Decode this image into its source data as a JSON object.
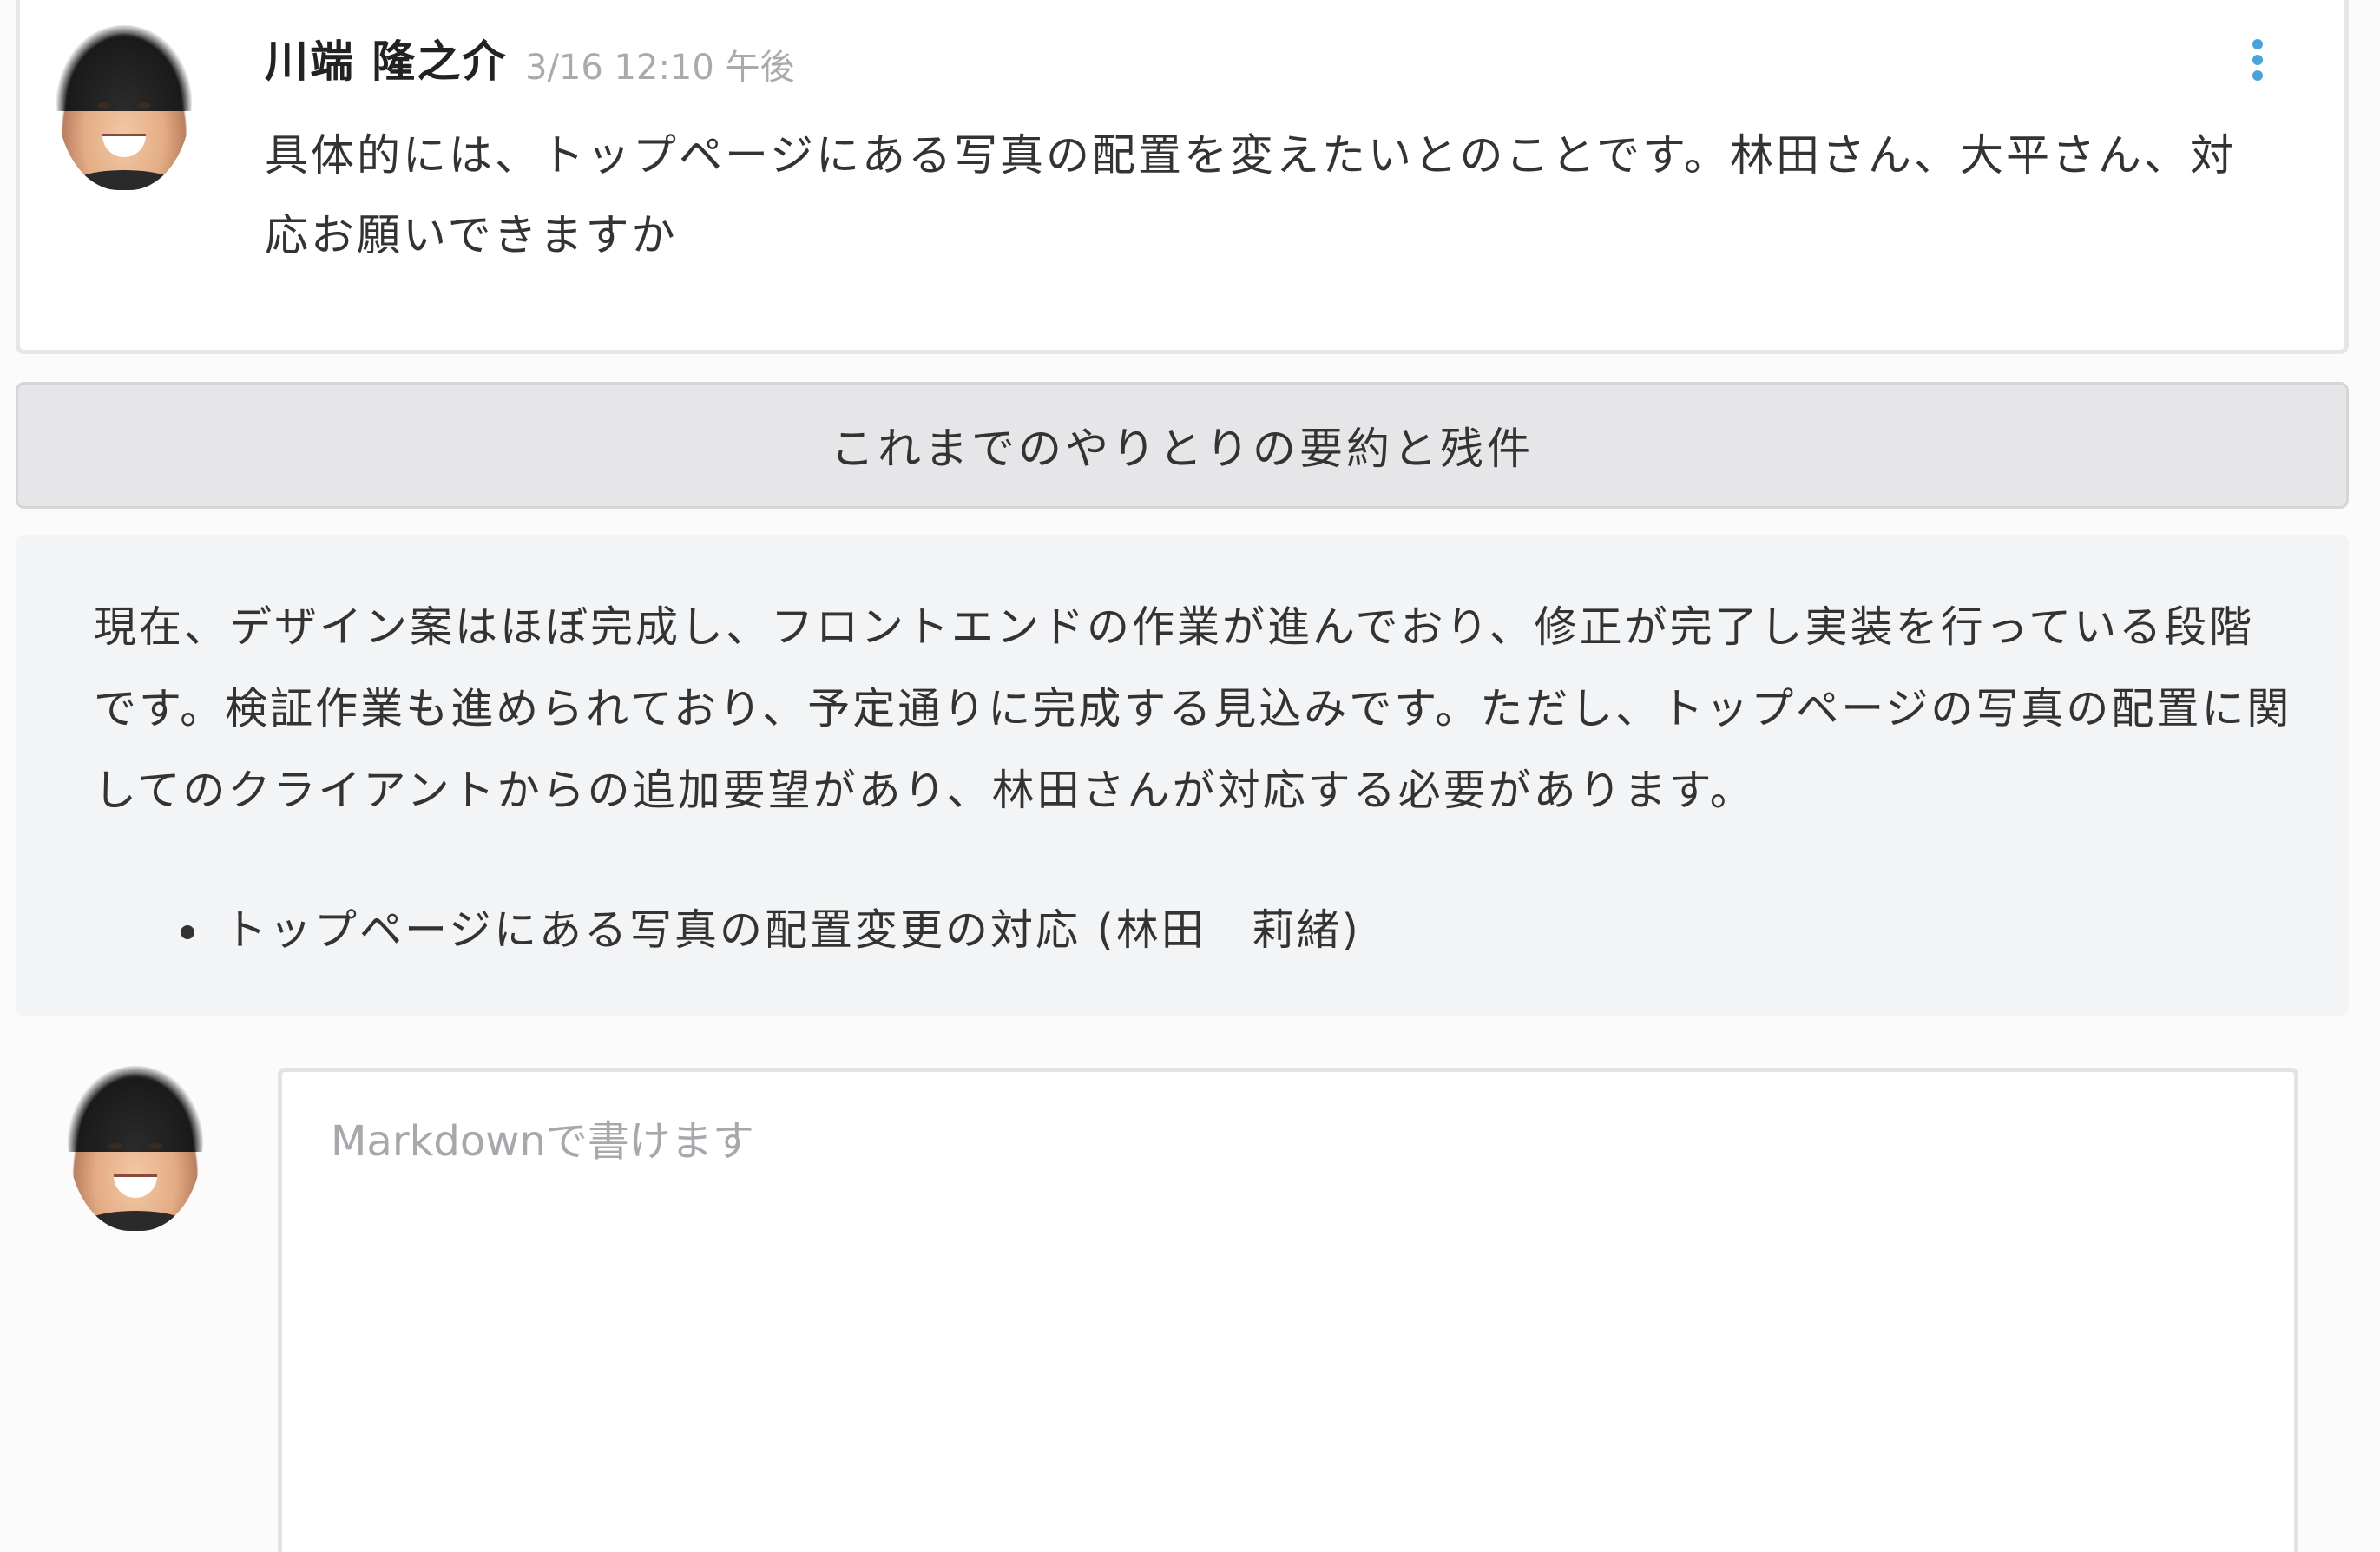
{
  "comment": {
    "author": "川端 隆之介",
    "timestamp": "3/16 12:10 午後",
    "body": "具体的には、トップページにある写真の配置を変えたいとのことです。林田さん、大平さん、対応お願いできますか",
    "menu_icon": "more-vertical-icon",
    "avatar_icon": "user-avatar"
  },
  "summary": {
    "button_label": "これまでのやりとりの要約と残件",
    "text": "現在、デザイン案はほぼ完成し、フロントエンドの作業が進んでおり、修正が完了し実装を行っている段階です。検証作業も進められており、予定通りに完成する見込みです。ただし、トップページの写真の配置に関してのクライアントからの追加要望があり、林田さんが対応する必要があります。",
    "tasks": [
      "トップページにある写真の配置変更の対応 (林田　莉緒)"
    ]
  },
  "reply": {
    "placeholder": "Markdownで書けます",
    "value": ""
  },
  "colors": {
    "accent": "#4aa3d8",
    "card_border": "#e6e6e8",
    "summary_bg": "#f3f4f6",
    "timestamp": "#aaaaaa"
  }
}
